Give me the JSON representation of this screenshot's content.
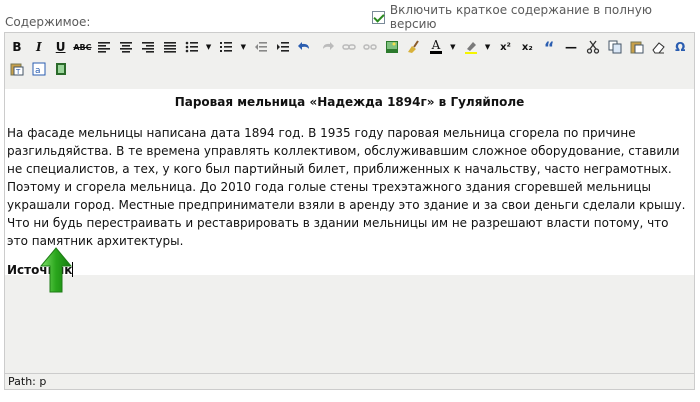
{
  "header": {
    "include_summary_label": "Включить краткое содержание в полную версию",
    "include_summary_checked": true,
    "field_label": "Содержимое:"
  },
  "toolbar": {
    "row1": [
      {
        "name": "bold-button",
        "glyph": "B"
      },
      {
        "name": "italic-button",
        "glyph": "I"
      },
      {
        "name": "underline-button",
        "glyph": "U"
      },
      {
        "name": "strikethrough-button",
        "glyph": "ABC"
      },
      {
        "name": "align-left-button",
        "icon": "align-left-icon"
      },
      {
        "name": "align-center-button",
        "icon": "align-center-icon"
      },
      {
        "name": "align-right-button",
        "icon": "align-right-icon"
      },
      {
        "name": "align-justify-button",
        "icon": "align-justify-icon"
      },
      {
        "name": "bullet-list-button",
        "icon": "bullet-list-icon"
      },
      {
        "name": "numbered-list-button",
        "icon": "numbered-list-icon"
      },
      {
        "name": "outdent-button",
        "icon": "outdent-icon"
      },
      {
        "name": "indent-button",
        "icon": "indent-icon"
      },
      {
        "name": "undo-button",
        "icon": "undo-icon"
      },
      {
        "name": "redo-button",
        "icon": "redo-icon"
      },
      {
        "name": "link-button",
        "icon": "link-icon"
      },
      {
        "name": "unlink-button",
        "icon": "unlink-icon"
      },
      {
        "name": "image-button",
        "icon": "image-icon"
      },
      {
        "name": "cleanup-button",
        "icon": "broom-icon"
      },
      {
        "name": "font-color-button",
        "glyph": "A"
      },
      {
        "name": "highlight-button",
        "icon": "highlighter-icon"
      },
      {
        "name": "superscript-button",
        "glyph": "x²"
      },
      {
        "name": "subscript-button",
        "glyph": "x₂"
      },
      {
        "name": "blockquote-button",
        "glyph": "“"
      },
      {
        "name": "horizontal-rule-button",
        "glyph": "—"
      },
      {
        "name": "cut-button",
        "icon": "scissors-icon"
      },
      {
        "name": "copy-button",
        "icon": "copy-icon"
      },
      {
        "name": "paste-button",
        "icon": "paste-icon"
      },
      {
        "name": "remove-format-button",
        "icon": "eraser-icon"
      },
      {
        "name": "special-char-button",
        "glyph": "Ω"
      }
    ],
    "row2": [
      {
        "name": "paste-text-button",
        "icon": "paste-text-icon"
      },
      {
        "name": "paste-word-button",
        "icon": "paste-word-icon"
      },
      {
        "name": "media-button",
        "icon": "film-icon"
      }
    ]
  },
  "document": {
    "title": "Паровая мельница «Надежда 1894г» в Гуляйполе",
    "body": "На фасаде мельницы написана дата 1894 год. В 1935 году паровая мельница сгорела по причине разгильдяйства. В те времена управлять коллективом, обслуживавшим сложное оборудование, ставили не специалистов, а тех, у кого был партийный билет, приближенных к начальству, часто неграмотных. Поэтому и сгорела мельница. До 2010 года голые стены трехэтажного здания сгоревшей мельницы украшали город. Местные предприниматели взяли в аренду это здание и за свои деньги сделали крышу. Что ни будь перестраивать и реставрировать в здании мельницы им не разрешают власти потому, что это памятник архитектуры.",
    "source_label": "Источник"
  },
  "status": {
    "path_label": "Path: p"
  },
  "colors": {
    "toolbar_bg": "#f0f0ee",
    "arrow_green": "#2aa61c"
  }
}
